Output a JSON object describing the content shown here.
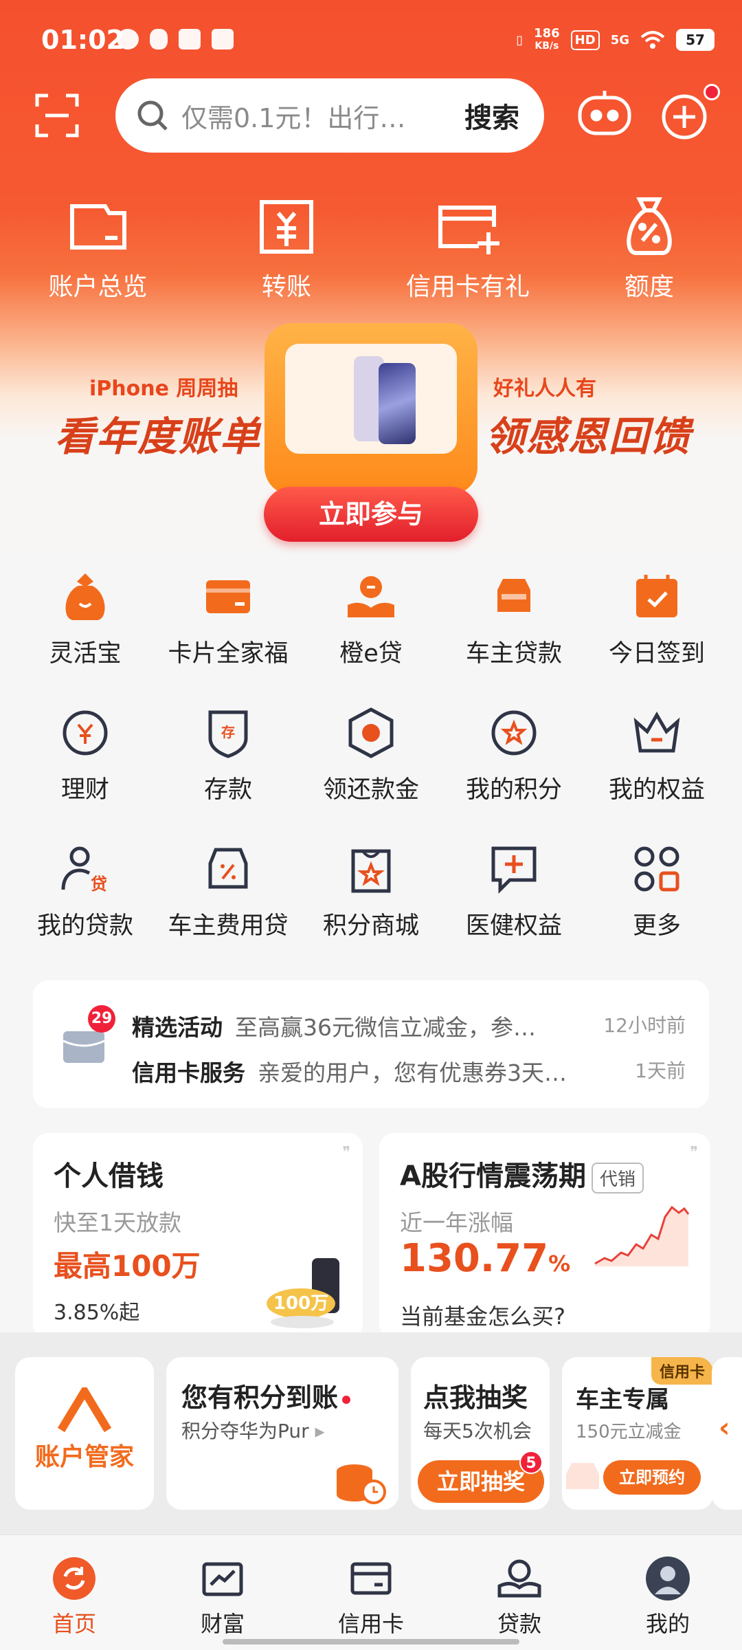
{
  "status": {
    "time": "01:02",
    "speed": "186",
    "speed_unit": "KB/s",
    "hd": "HD",
    "network": "5G",
    "battery": "57"
  },
  "search": {
    "placeholder": "仅需0.1元！出行…",
    "button": "搜索"
  },
  "top_nav": [
    {
      "label": "账户总览"
    },
    {
      "label": "转账"
    },
    {
      "label": "信用卡有礼"
    },
    {
      "label": "额度"
    }
  ],
  "banner": {
    "left_small": "iPhone 周周抽",
    "left_big": "看年度账单",
    "right_small": "好礼人人有",
    "right_big": "领感恩回馈",
    "button": "立即参与"
  },
  "grid": [
    {
      "label": "灵活宝"
    },
    {
      "label": "卡片全家福"
    },
    {
      "label": "橙e贷"
    },
    {
      "label": "车主贷款"
    },
    {
      "label": "今日签到"
    },
    {
      "label": "理财"
    },
    {
      "label": "存款"
    },
    {
      "label": "领还款金"
    },
    {
      "label": "我的积分"
    },
    {
      "label": "我的权益"
    },
    {
      "label": "我的贷款"
    },
    {
      "label": "车主费用贷"
    },
    {
      "label": "积分商城"
    },
    {
      "label": "医健权益"
    },
    {
      "label": "更多"
    }
  ],
  "notice": {
    "badge": "29",
    "rows": [
      {
        "title": "精选活动",
        "desc": "至高赢36元微信立减金，参…",
        "time": "12小时前"
      },
      {
        "title": "信用卡服务",
        "desc": "亲爱的用户，您有优惠券3天…",
        "time": "1天前"
      }
    ]
  },
  "card_loan": {
    "title": "个人借钱",
    "sub": "快至1天放款",
    "big": "最高100万",
    "small": "3.85%起",
    "art": "100万"
  },
  "card_fund": {
    "title": "A股行情震荡期",
    "tag": "代销",
    "sub": "近一年涨幅",
    "pct": "130.77",
    "pct_unit": "%",
    "question": "当前基金怎么买?"
  },
  "promos": {
    "manager": {
      "label": "账户管家"
    },
    "points": {
      "title": "您有积分到账",
      "sub": "积分夺华为Pur"
    },
    "lottery": {
      "title": "点我抽奖",
      "sub": "每天5次机会",
      "button": "立即抽奖",
      "badge": "5"
    },
    "car": {
      "title": "车主专属",
      "sub": "150元立减金",
      "tag": "信用卡",
      "button": "立即预约"
    }
  },
  "tabs": [
    {
      "label": "首页"
    },
    {
      "label": "财富"
    },
    {
      "label": "信用卡"
    },
    {
      "label": "贷款"
    },
    {
      "label": "我的"
    }
  ],
  "colors": {
    "brand": "#f5502e",
    "accent": "#e8501e",
    "badge": "#f0223a"
  }
}
